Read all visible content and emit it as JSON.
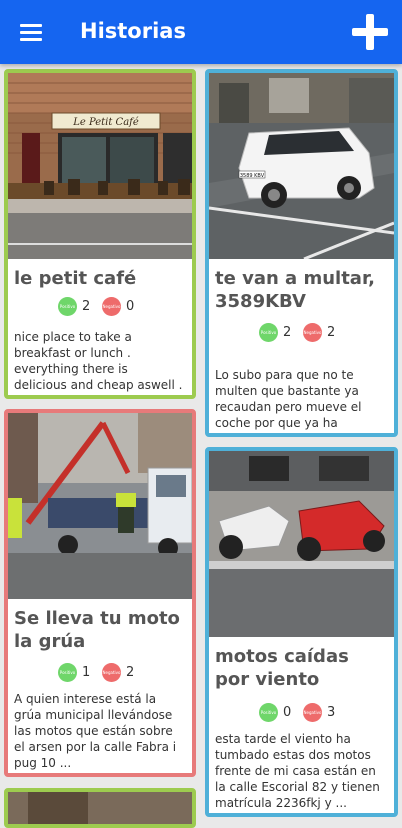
{
  "app": {
    "title": "Historias",
    "menu_icon": "hamburger-menu-icon",
    "add_icon": "plus-icon",
    "colors": {
      "app_bar": "#1565f0",
      "positive": "#6fd66a",
      "negative": "#ee6b6b",
      "border_green": "#9dcb4f",
      "border_blue": "#4fb0d8",
      "border_red": "#e77a7a"
    }
  },
  "vote_labels": {
    "positive": "Positivo",
    "negative": "Negativo"
  },
  "stories": [
    {
      "title": "le petit café",
      "positive": "2",
      "negative": "0",
      "description": "nice place to take a breakfast or lunch . everything there is delicious and cheap aswell ."
    },
    {
      "title": "te van a multar, 3589KBV",
      "positive": "2",
      "negative": "2",
      "description": "Lo subo para que no te multen que bastante ya recaudan pero mueve el coche  por que ya ha pasad..."
    },
    {
      "title": "Se lleva tu moto la grúa",
      "positive": "1",
      "negative": "2",
      "description": "A quien interese está la grúa municipal llevándose las motos que están sobre el arsen por la calle Fabra i pug 10 ..."
    },
    {
      "title": "motos caídas por viento",
      "positive": "0",
      "negative": "3",
      "description": "esta tarde el viento ha tumbado estas dos motos frente de mi casa están en la calle Escorial 82 y tienen matrícula 2236fkj  y ..."
    }
  ],
  "cafe_sign": "Le Petit Café",
  "car_plate": "3589 KBV"
}
